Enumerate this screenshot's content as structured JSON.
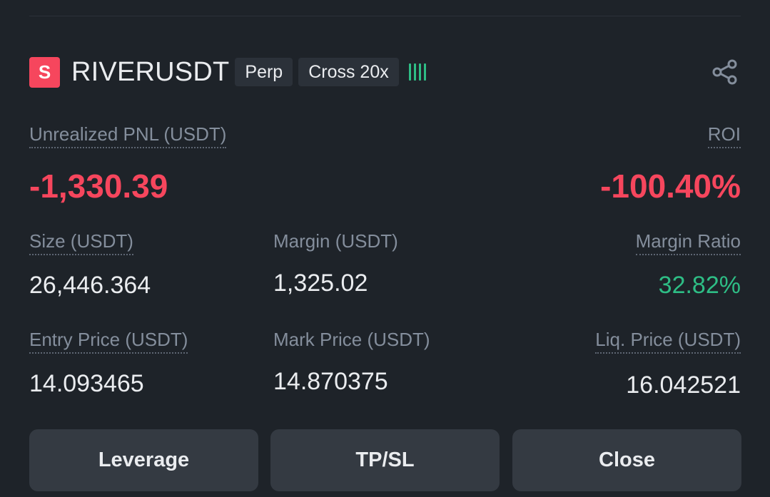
{
  "header": {
    "badge_letter": "S",
    "symbol": "RIVERUSDT",
    "contract_type": "Perp",
    "margin_mode": "Cross 20x",
    "share_icon": "share-icon"
  },
  "pnl": {
    "label": "Unrealized PNL (USDT)",
    "value": "-1,330.39"
  },
  "roi": {
    "label": "ROI",
    "value": "-100.40%"
  },
  "size": {
    "label": "Size (USDT)",
    "value": "26,446.364"
  },
  "margin": {
    "label": "Margin (USDT)",
    "value": "1,325.02"
  },
  "margin_ratio": {
    "label": "Margin Ratio",
    "value": "32.82%"
  },
  "entry_price": {
    "label": "Entry Price (USDT)",
    "value": "14.093465"
  },
  "mark_price": {
    "label": "Mark Price (USDT)",
    "value": "14.870375"
  },
  "liq_price": {
    "label": "Liq. Price (USDT)",
    "value": "16.042521"
  },
  "actions": {
    "leverage": "Leverage",
    "tpsl": "TP/SL",
    "close": "Close"
  },
  "colors": {
    "background": "#1e2329",
    "loss": "#f6465d",
    "profit": "#2ebd85",
    "muted": "#848e9c",
    "button": "#343a42"
  }
}
